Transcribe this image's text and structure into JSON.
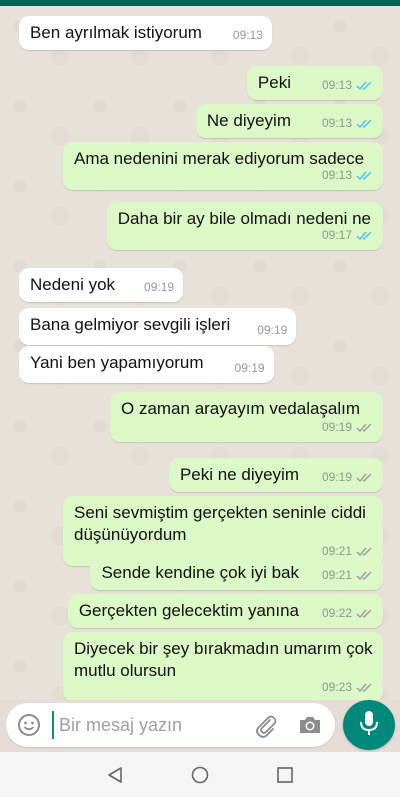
{
  "messages": [
    {
      "dir": "in",
      "text": "Ben ayrılmak istiyorum",
      "time": "09:13"
    },
    {
      "dir": "out",
      "text": "Peki",
      "time": "09:13",
      "status": "read"
    },
    {
      "dir": "out",
      "text": "Ne diyeyim",
      "time": "09:13",
      "status": "read"
    },
    {
      "dir": "out",
      "text": "Ama nedenini merak ediyorum sadece",
      "time": "09:13",
      "status": "read"
    },
    {
      "dir": "out",
      "text": "Daha bir ay bile olmadı nedeni ne",
      "time": "09:17",
      "status": "read"
    },
    {
      "dir": "in",
      "text": "Nedeni yok",
      "time": "09:19"
    },
    {
      "dir": "in",
      "text": "Bana gelmiyor sevgili işleri",
      "time": "09:19"
    },
    {
      "dir": "in",
      "text": "Yani ben yapamıyorum",
      "time": "09:19"
    },
    {
      "dir": "out",
      "text": "O zaman arayayım vedalaşalım",
      "time": "09:19",
      "status": "delivered"
    },
    {
      "dir": "out",
      "text": "Peki ne diyeyim",
      "time": "09:19",
      "status": "delivered"
    },
    {
      "dir": "out",
      "text": "Seni sevmiştim gerçekten seninle ciddi düşünüyordum",
      "time": "09:21",
      "status": "delivered"
    },
    {
      "dir": "out",
      "text": "Sende kendine çok iyi bak",
      "time": "09:21",
      "status": "delivered"
    },
    {
      "dir": "out",
      "text": "Gerçekten gelecektim yanına",
      "time": "09:22",
      "status": "delivered"
    },
    {
      "dir": "out",
      "text": "Diyecek bir şey bırakmadın umarım çok mutlu olursun",
      "time": "09:23",
      "status": "delivered"
    }
  ],
  "composer": {
    "placeholder": "Bir mesaj yazın",
    "icons": [
      "emoji-icon",
      "attach-icon",
      "camera-icon",
      "mic-icon"
    ]
  },
  "navbar": {
    "icons": [
      "back-icon",
      "home-icon",
      "recents-icon"
    ]
  },
  "colors": {
    "header": "#075e54",
    "incoming_bubble": "#ffffff",
    "outgoing_bubble": "#dcf8c6",
    "read_tick": "#4fc3f7",
    "delivered_tick": "#9e9e9e",
    "mic_button": "#00897b"
  }
}
